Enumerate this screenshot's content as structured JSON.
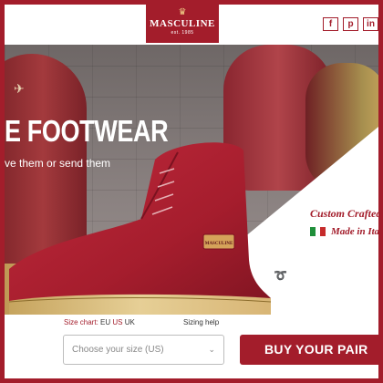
{
  "brand": {
    "name": "MASCULINE",
    "est": "est. 1985",
    "color": "#a31d2b"
  },
  "socials": [
    {
      "icon": "facebook-icon",
      "glyph": "f"
    },
    {
      "icon": "pinterest-icon",
      "glyph": "p"
    },
    {
      "icon": "instagram-icon",
      "glyph": "in"
    }
  ],
  "hero": {
    "headline": "E FOOTWEAR",
    "subline": "ve them or send them",
    "badge_line1": "Custom Crafted",
    "badge_line2": "Made in Italy",
    "flag_colors": [
      "#1f8f3a",
      "#ffffff",
      "#c62b2b"
    ],
    "label_on_shoe": "MASCULINE"
  },
  "size_selector": {
    "label": "Size chart:",
    "options": [
      "EU",
      "US",
      "UK"
    ],
    "selected": "US",
    "help": "Sizing help",
    "placeholder": "Choose your size (US)"
  },
  "cta": {
    "label": "BUY YOUR PAIR"
  }
}
